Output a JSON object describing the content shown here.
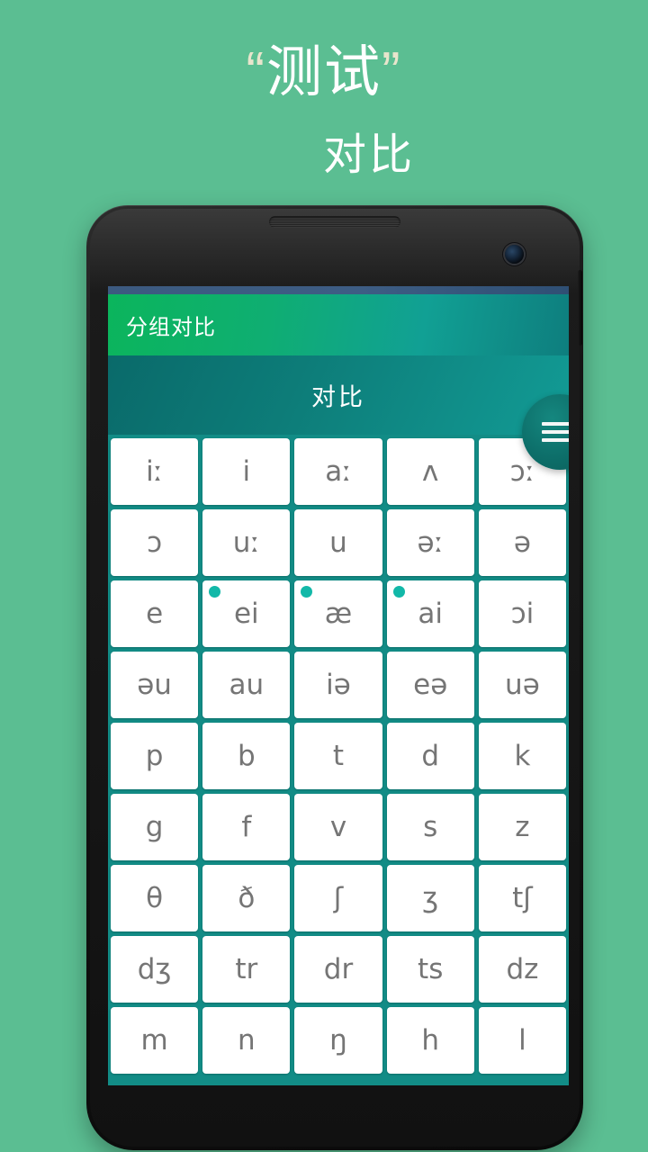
{
  "promo": {
    "quote_open": "“",
    "title_text": "测试",
    "quote_close": "”",
    "subtitle": "对比"
  },
  "colors": {
    "page_background": "#5bbe92",
    "appbar_gradient_start": "#0bb55c",
    "appbar_gradient_end": "#0e7e7e",
    "section_gradient_start": "#0a6a6a",
    "section_gradient_end": "#129b95",
    "grid_background": "#128c86",
    "cell_background": "#ffffff",
    "cell_text": "#757575",
    "selection_dot": "#12b8a8",
    "statusbar": "#3c5a80",
    "quote_mark": "#e8e5cc"
  },
  "app": {
    "appbar_title": "分组对比",
    "menu_icon": "hamburger-menu-icon",
    "section_title": "对比"
  },
  "grid": {
    "columns": 5,
    "rows": [
      [
        {
          "label": "iː",
          "selected": false
        },
        {
          "label": "i",
          "selected": false
        },
        {
          "label": "aː",
          "selected": false
        },
        {
          "label": "ʌ",
          "selected": false
        },
        {
          "label": "ɔː",
          "selected": false
        }
      ],
      [
        {
          "label": "ɔ",
          "selected": false
        },
        {
          "label": "uː",
          "selected": false
        },
        {
          "label": "u",
          "selected": false
        },
        {
          "label": "əː",
          "selected": false
        },
        {
          "label": "ə",
          "selected": false
        }
      ],
      [
        {
          "label": "e",
          "selected": false
        },
        {
          "label": "ei",
          "selected": true
        },
        {
          "label": "æ",
          "selected": true
        },
        {
          "label": "ai",
          "selected": true
        },
        {
          "label": "ɔi",
          "selected": false
        }
      ],
      [
        {
          "label": "əu",
          "selected": false
        },
        {
          "label": "au",
          "selected": false
        },
        {
          "label": "iə",
          "selected": false
        },
        {
          "label": "eə",
          "selected": false
        },
        {
          "label": "uə",
          "selected": false
        }
      ],
      [
        {
          "label": "p",
          "selected": false
        },
        {
          "label": "b",
          "selected": false
        },
        {
          "label": "t",
          "selected": false
        },
        {
          "label": "d",
          "selected": false
        },
        {
          "label": "k",
          "selected": false
        }
      ],
      [
        {
          "label": "g",
          "selected": false
        },
        {
          "label": "f",
          "selected": false
        },
        {
          "label": "v",
          "selected": false
        },
        {
          "label": "s",
          "selected": false
        },
        {
          "label": "z",
          "selected": false
        }
      ],
      [
        {
          "label": "θ",
          "selected": false
        },
        {
          "label": "ð",
          "selected": false
        },
        {
          "label": "ʃ",
          "selected": false
        },
        {
          "label": "ʒ",
          "selected": false
        },
        {
          "label": "tʃ",
          "selected": false
        }
      ],
      [
        {
          "label": "dʒ",
          "selected": false
        },
        {
          "label": "tr",
          "selected": false
        },
        {
          "label": "dr",
          "selected": false
        },
        {
          "label": "ts",
          "selected": false
        },
        {
          "label": "dz",
          "selected": false
        }
      ],
      [
        {
          "label": "m",
          "selected": false
        },
        {
          "label": "n",
          "selected": false
        },
        {
          "label": "ŋ",
          "selected": false
        },
        {
          "label": "h",
          "selected": false
        },
        {
          "label": "l",
          "selected": false
        }
      ]
    ]
  }
}
